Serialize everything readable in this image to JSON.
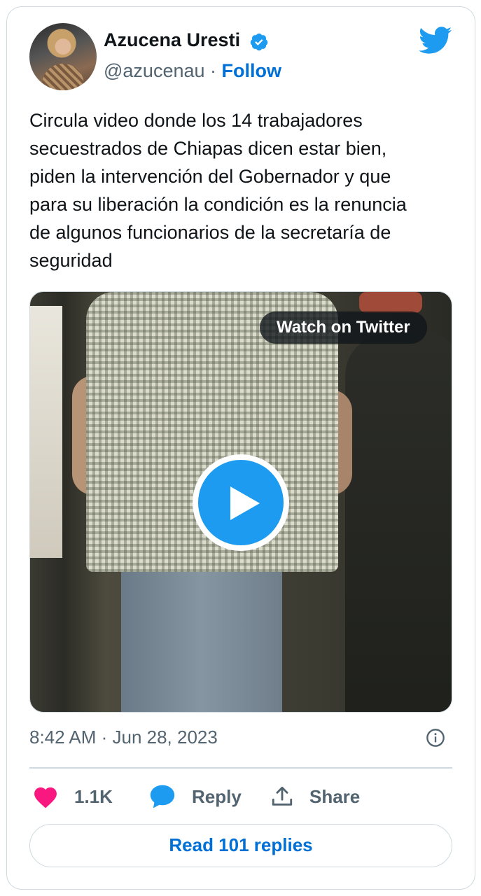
{
  "author": {
    "name": "Azucena Uresti",
    "handle": "@azucenau",
    "separator": "·",
    "follow_label": "Follow"
  },
  "tweet": {
    "lines": [
      "Circula video donde los 14 trabajadores",
      "secuestrados de Chiapas dicen estar bien,",
      "piden la intervención del Gobernador y que",
      "para su liberación la condición es la renuncia",
      "de algunos funcionarios de la secretaría de",
      "seguridad"
    ]
  },
  "media": {
    "watch_label": "Watch on Twitter"
  },
  "meta": {
    "timestamp": "8:42 AM · Jun 28, 2023"
  },
  "actions": {
    "likes": "1.1K",
    "reply_label": "Reply",
    "share_label": "Share"
  },
  "replies_button": "Read 101 replies",
  "colors": {
    "twitter_blue": "#1d9bf0",
    "link_blue": "#006fd6",
    "heart": "#f91880",
    "secondary_text": "#536471",
    "border": "#cfd9de"
  },
  "icons": [
    "verified-badge-icon",
    "twitter-bird-icon",
    "play-icon",
    "info-icon",
    "heart-icon",
    "reply-bubble-icon",
    "share-icon"
  ]
}
